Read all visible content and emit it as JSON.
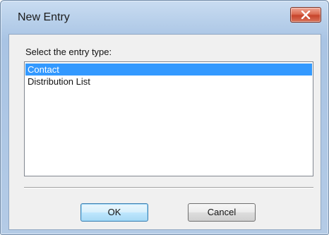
{
  "window": {
    "title": "New Entry",
    "close_icon": "close-x-icon",
    "close_color": "#c7432a"
  },
  "dialog": {
    "prompt": "Select the entry type:",
    "entry_types": [
      {
        "label": "Contact",
        "selected": true
      },
      {
        "label": "Distribution List",
        "selected": false
      }
    ],
    "selection_color": "#3399ff"
  },
  "buttons": {
    "ok_label": "OK",
    "cancel_label": "Cancel"
  }
}
